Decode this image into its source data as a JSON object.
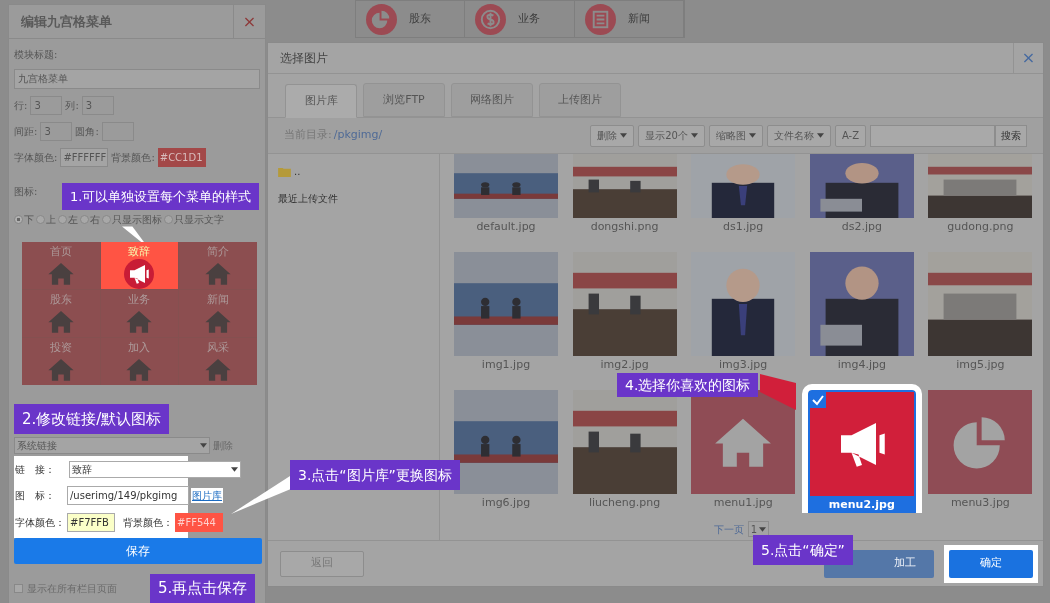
{
  "background_menu": [
    {
      "label": "股东",
      "kind": "pie"
    },
    {
      "label": "业务",
      "kind": "dollar"
    },
    {
      "label": "新闻",
      "kind": "doc"
    }
  ],
  "editor": {
    "title": "编辑九宫格菜单",
    "close": "×",
    "module_title_label": "模块标题:",
    "module_title": "九宫格菜单",
    "rows_label": "行:",
    "rows": "3",
    "cols_label": "列:",
    "cols": "3",
    "spacing_label": "间距:",
    "spacing": "3",
    "radius_label": "圆角:",
    "font_color_label": "字体颜色:",
    "font_color": "#FFFFFF",
    "bg_color_label": "背景颜色:",
    "bg_color": "#CC1D1",
    "icon_label": "图标:",
    "icon_positions": [
      {
        "label": "下",
        "selected": true
      },
      {
        "label": "上",
        "selected": false
      },
      {
        "label": "左",
        "selected": false
      },
      {
        "label": "右",
        "selected": false
      },
      {
        "label": "只显示图标",
        "selected": false
      },
      {
        "label": "只显示文字",
        "selected": false
      }
    ],
    "grid": [
      {
        "label": "首页",
        "kind": "house",
        "selected": false
      },
      {
        "label": "致辞",
        "kind": "megaphone",
        "selected": true
      },
      {
        "label": "简介",
        "kind": "house",
        "selected": false
      },
      {
        "label": "股东",
        "kind": "house",
        "selected": false
      },
      {
        "label": "业务",
        "kind": "house",
        "selected": false
      },
      {
        "label": "新闻",
        "kind": "house",
        "selected": false
      },
      {
        "label": "投资",
        "kind": "house",
        "selected": false
      },
      {
        "label": "加入",
        "kind": "house",
        "selected": false
      },
      {
        "label": "风采",
        "kind": "house",
        "selected": false
      }
    ],
    "link_type": "系统链接",
    "delete": "删除",
    "link_label": "链　接：",
    "link": "致辞",
    "icon_field_label": "图　标：",
    "icon_path": "/userimg/149/pkgimg",
    "gallery_link": "图片库",
    "item_font_color_label": "字体颜色：",
    "item_font_color": "#F7FFB",
    "item_bg_color_label": "背景颜色：",
    "item_bg_color": "#FF544",
    "save": "保存",
    "show_all_label": "显示在所有栏目页面",
    "show_all_checked": false
  },
  "dialog": {
    "title": "选择图片",
    "close": "×",
    "tabs": [
      {
        "label": "图片库",
        "selected": true
      },
      {
        "label": "浏览FTP",
        "selected": false
      },
      {
        "label": "网络图片",
        "selected": false
      },
      {
        "label": "上传图片",
        "selected": false
      }
    ],
    "path_label": "当前目录:",
    "path": "/pkgimg/",
    "toolbar": [
      {
        "label": "删除",
        "kind": "menu"
      },
      {
        "label": "显示20个",
        "kind": "menu"
      },
      {
        "label": "缩略图",
        "kind": "menu"
      },
      {
        "label": "文件名称",
        "kind": "menu"
      },
      {
        "label": "A-Z",
        "kind": "plain"
      }
    ],
    "search": "搜索",
    "folders": [
      {
        "label": ".."
      },
      {
        "label": "最近上传文件"
      }
    ],
    "images": [
      {
        "name": "default.jpg",
        "kind": "picture",
        "selected": false
      },
      {
        "name": "dongshi.png",
        "kind": "picture",
        "selected": false
      },
      {
        "name": "ds1.jpg",
        "kind": "picture",
        "selected": false
      },
      {
        "name": "ds2.jpg",
        "kind": "picture",
        "selected": false
      },
      {
        "name": "gudong.png",
        "kind": "picture",
        "selected": false
      },
      {
        "name": "img1.jpg",
        "kind": "picture",
        "selected": false
      },
      {
        "name": "img2.jpg",
        "kind": "picture",
        "selected": false
      },
      {
        "name": "img3.jpg",
        "kind": "picture",
        "selected": false
      },
      {
        "name": "img4.jpg",
        "kind": "picture",
        "selected": false
      },
      {
        "name": "img5.jpg",
        "kind": "picture",
        "selected": false
      },
      {
        "name": "img6.jpg",
        "kind": "picture",
        "selected": false
      },
      {
        "name": "liucheng.png",
        "kind": "picture",
        "selected": false
      },
      {
        "name": "menu1.jpg",
        "kind": "house",
        "selected": false
      },
      {
        "name": "menu2.jpg",
        "kind": "megaphone",
        "selected": true
      },
      {
        "name": "menu3.jpg",
        "kind": "pie",
        "selected": false
      }
    ],
    "next_page": "下一页",
    "page": "1",
    "back": "返回",
    "upload": "加工",
    "ok": "确定"
  },
  "callouts": [
    "1.可以单独设置每个菜单的样式",
    "2.修改链接/默认图标",
    "3.点击“图片库”更换图标",
    "4.选择你喜欢的图标",
    "5.点击“确定”",
    "5.再点击保存"
  ]
}
